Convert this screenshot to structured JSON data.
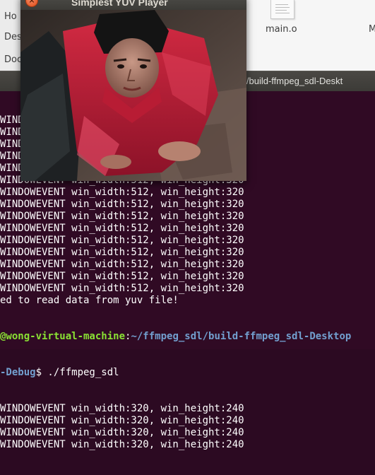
{
  "file_manager": {
    "sidebar_items": [
      "Ho",
      "Des",
      "Doc"
    ],
    "file_name": "main.o",
    "file_name_2": "M"
  },
  "terminal": {
    "title": "l/build-ffmpeg_sdl-Deskt",
    "lines": [
      {
        "text": "WINDOWEVENT win_width:512, win_height:320"
      },
      {
        "text": "WINDOWEVENT win_width:512, win_height:320"
      },
      {
        "text": "WINDOWEVENT win_width:512, win_height:320"
      },
      {
        "text": "WINDOWEVENT win_width:512, win_height:320"
      },
      {
        "text": "WINDOWEVENT win_width:512, win_height:320"
      },
      {
        "text": "WINDOWEVENT win_width:512, win_height:320"
      },
      {
        "text": "WINDOWEVENT win_width:512, win_height:320"
      },
      {
        "text": "WINDOWEVENT win_width:512, win_height:320"
      },
      {
        "text": "WINDOWEVENT win_width:512, win_height:320"
      },
      {
        "text": "WINDOWEVENT win_width:512, win_height:320"
      },
      {
        "text": "WINDOWEVENT win_width:512, win_height:320"
      },
      {
        "text": "WINDOWEVENT win_width:512, win_height:320"
      },
      {
        "text": "WINDOWEVENT win_width:512, win_height:320"
      },
      {
        "text": "WINDOWEVENT win_width:512, win_height:320"
      },
      {
        "text": "WINDOWEVENT win_width:512, win_height:320"
      },
      {
        "text": "ed to read data from yuv file!"
      }
    ],
    "prompt_user": "@wong-virtual-machine",
    "prompt_sep": ":",
    "prompt_path": "~/ffmpeg_sdl/build-ffmpeg_sdl-Desktop",
    "prompt_path_cont": "-Debug",
    "prompt_cmd": "$ ./ffmpeg_sdl",
    "after_lines": [
      "WINDOWEVENT win_width:320, win_height:240",
      "WINDOWEVENT win_width:320, win_height:240",
      "WINDOWEVENT win_width:320, win_height:240",
      "WINDOWEVENT win_width:320, win_height:240"
    ]
  },
  "player": {
    "title": "Simplest YUV Player",
    "close_symbol": "×"
  },
  "colors": {
    "terminal_bg": "#300a24",
    "prompt_green": "#8ae234",
    "prompt_blue": "#729fcf"
  }
}
